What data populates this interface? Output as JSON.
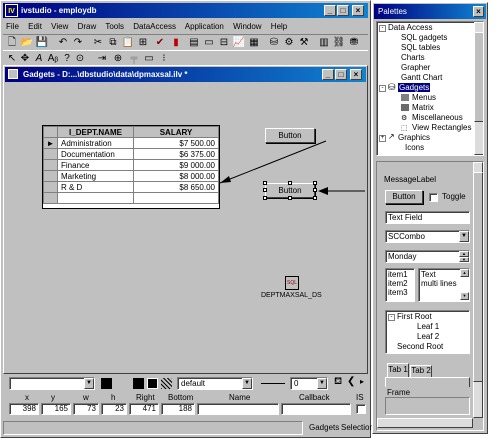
{
  "main_window": {
    "title": "ivstudio - employdb",
    "app_icon": "IV",
    "menu": [
      "File",
      "Edit",
      "View",
      "Draw",
      "Tools",
      "DataAccess",
      "Application",
      "Window",
      "Help"
    ]
  },
  "gadgets_window": {
    "title": "Gadgets - D:...\\dbstudio\\data\\dpmaxsal.ilv *"
  },
  "table": {
    "columns": [
      "I_DEPT.NAME",
      "SALARY"
    ],
    "rows": [
      {
        "name": "Administration",
        "salary": "$7 500.00",
        "current": true
      },
      {
        "name": "Documentation",
        "salary": "$6 375.00",
        "current": false
      },
      {
        "name": "Finance",
        "salary": "$9 000.00",
        "current": false
      },
      {
        "name": "Marketing",
        "salary": "$8 000.00",
        "current": false
      },
      {
        "name": "R & D",
        "salary": "$8 650.00",
        "current": false
      }
    ]
  },
  "canvas": {
    "button1_label": "Button",
    "button2_label": "Button",
    "datasource_label": "DEPTMAXSAL_DS",
    "datasource_icon_text": "SQL"
  },
  "bottom_toolbar": {
    "font_value": "default",
    "line_width_value": "0"
  },
  "inspector": {
    "headers": [
      "x",
      "y",
      "w",
      "h",
      "Right",
      "Bottom",
      "Name",
      "Callback",
      "IS"
    ],
    "values": [
      "398",
      "165",
      "73",
      "23",
      "471",
      "188",
      "",
      "",
      ""
    ]
  },
  "status_bar": {
    "gadgets_label": "Gadgets",
    "selection_label": "Selection"
  },
  "palettes": {
    "title": "Palettes",
    "tree": [
      {
        "label": "Data Access",
        "level": 0,
        "expander": "-"
      },
      {
        "label": "SQL gadgets",
        "level": 1
      },
      {
        "label": "SQL tables",
        "level": 1
      },
      {
        "label": "Charts",
        "level": 1
      },
      {
        "label": "Grapher",
        "level": 1
      },
      {
        "label": "Gantt Chart",
        "level": 1
      },
      {
        "label": "Gadgets",
        "level": 0,
        "expander": "-",
        "selected": true
      },
      {
        "label": "Menus",
        "level": 1
      },
      {
        "label": "Matrix",
        "level": 1
      },
      {
        "label": "Miscellaneous",
        "level": 1
      },
      {
        "label": "View Rectangles",
        "level": 1
      },
      {
        "label": "Graphics",
        "level": 0,
        "expander": "+"
      },
      {
        "label": "Icons",
        "level": 1
      }
    ],
    "preview": {
      "message_label": "MessageLabel",
      "button_label": "Button",
      "toggle_label": "Toggle",
      "text_field": "Text Field",
      "combo_value": "SCCombo",
      "spinner_value": "Monday",
      "list_items": [
        "item1",
        "item2",
        "item3"
      ],
      "textarea_lines": [
        "Text",
        "multi lines"
      ],
      "tree_items": [
        {
          "label": "First Root",
          "level": 0
        },
        {
          "label": "Leaf 1",
          "level": 2
        },
        {
          "label": "Leaf 2",
          "level": 2
        },
        {
          "label": "Second Root",
          "level": 1
        }
      ],
      "tabs": [
        "Tab 1",
        "Tab 2"
      ],
      "frame_label": "Frame"
    }
  }
}
